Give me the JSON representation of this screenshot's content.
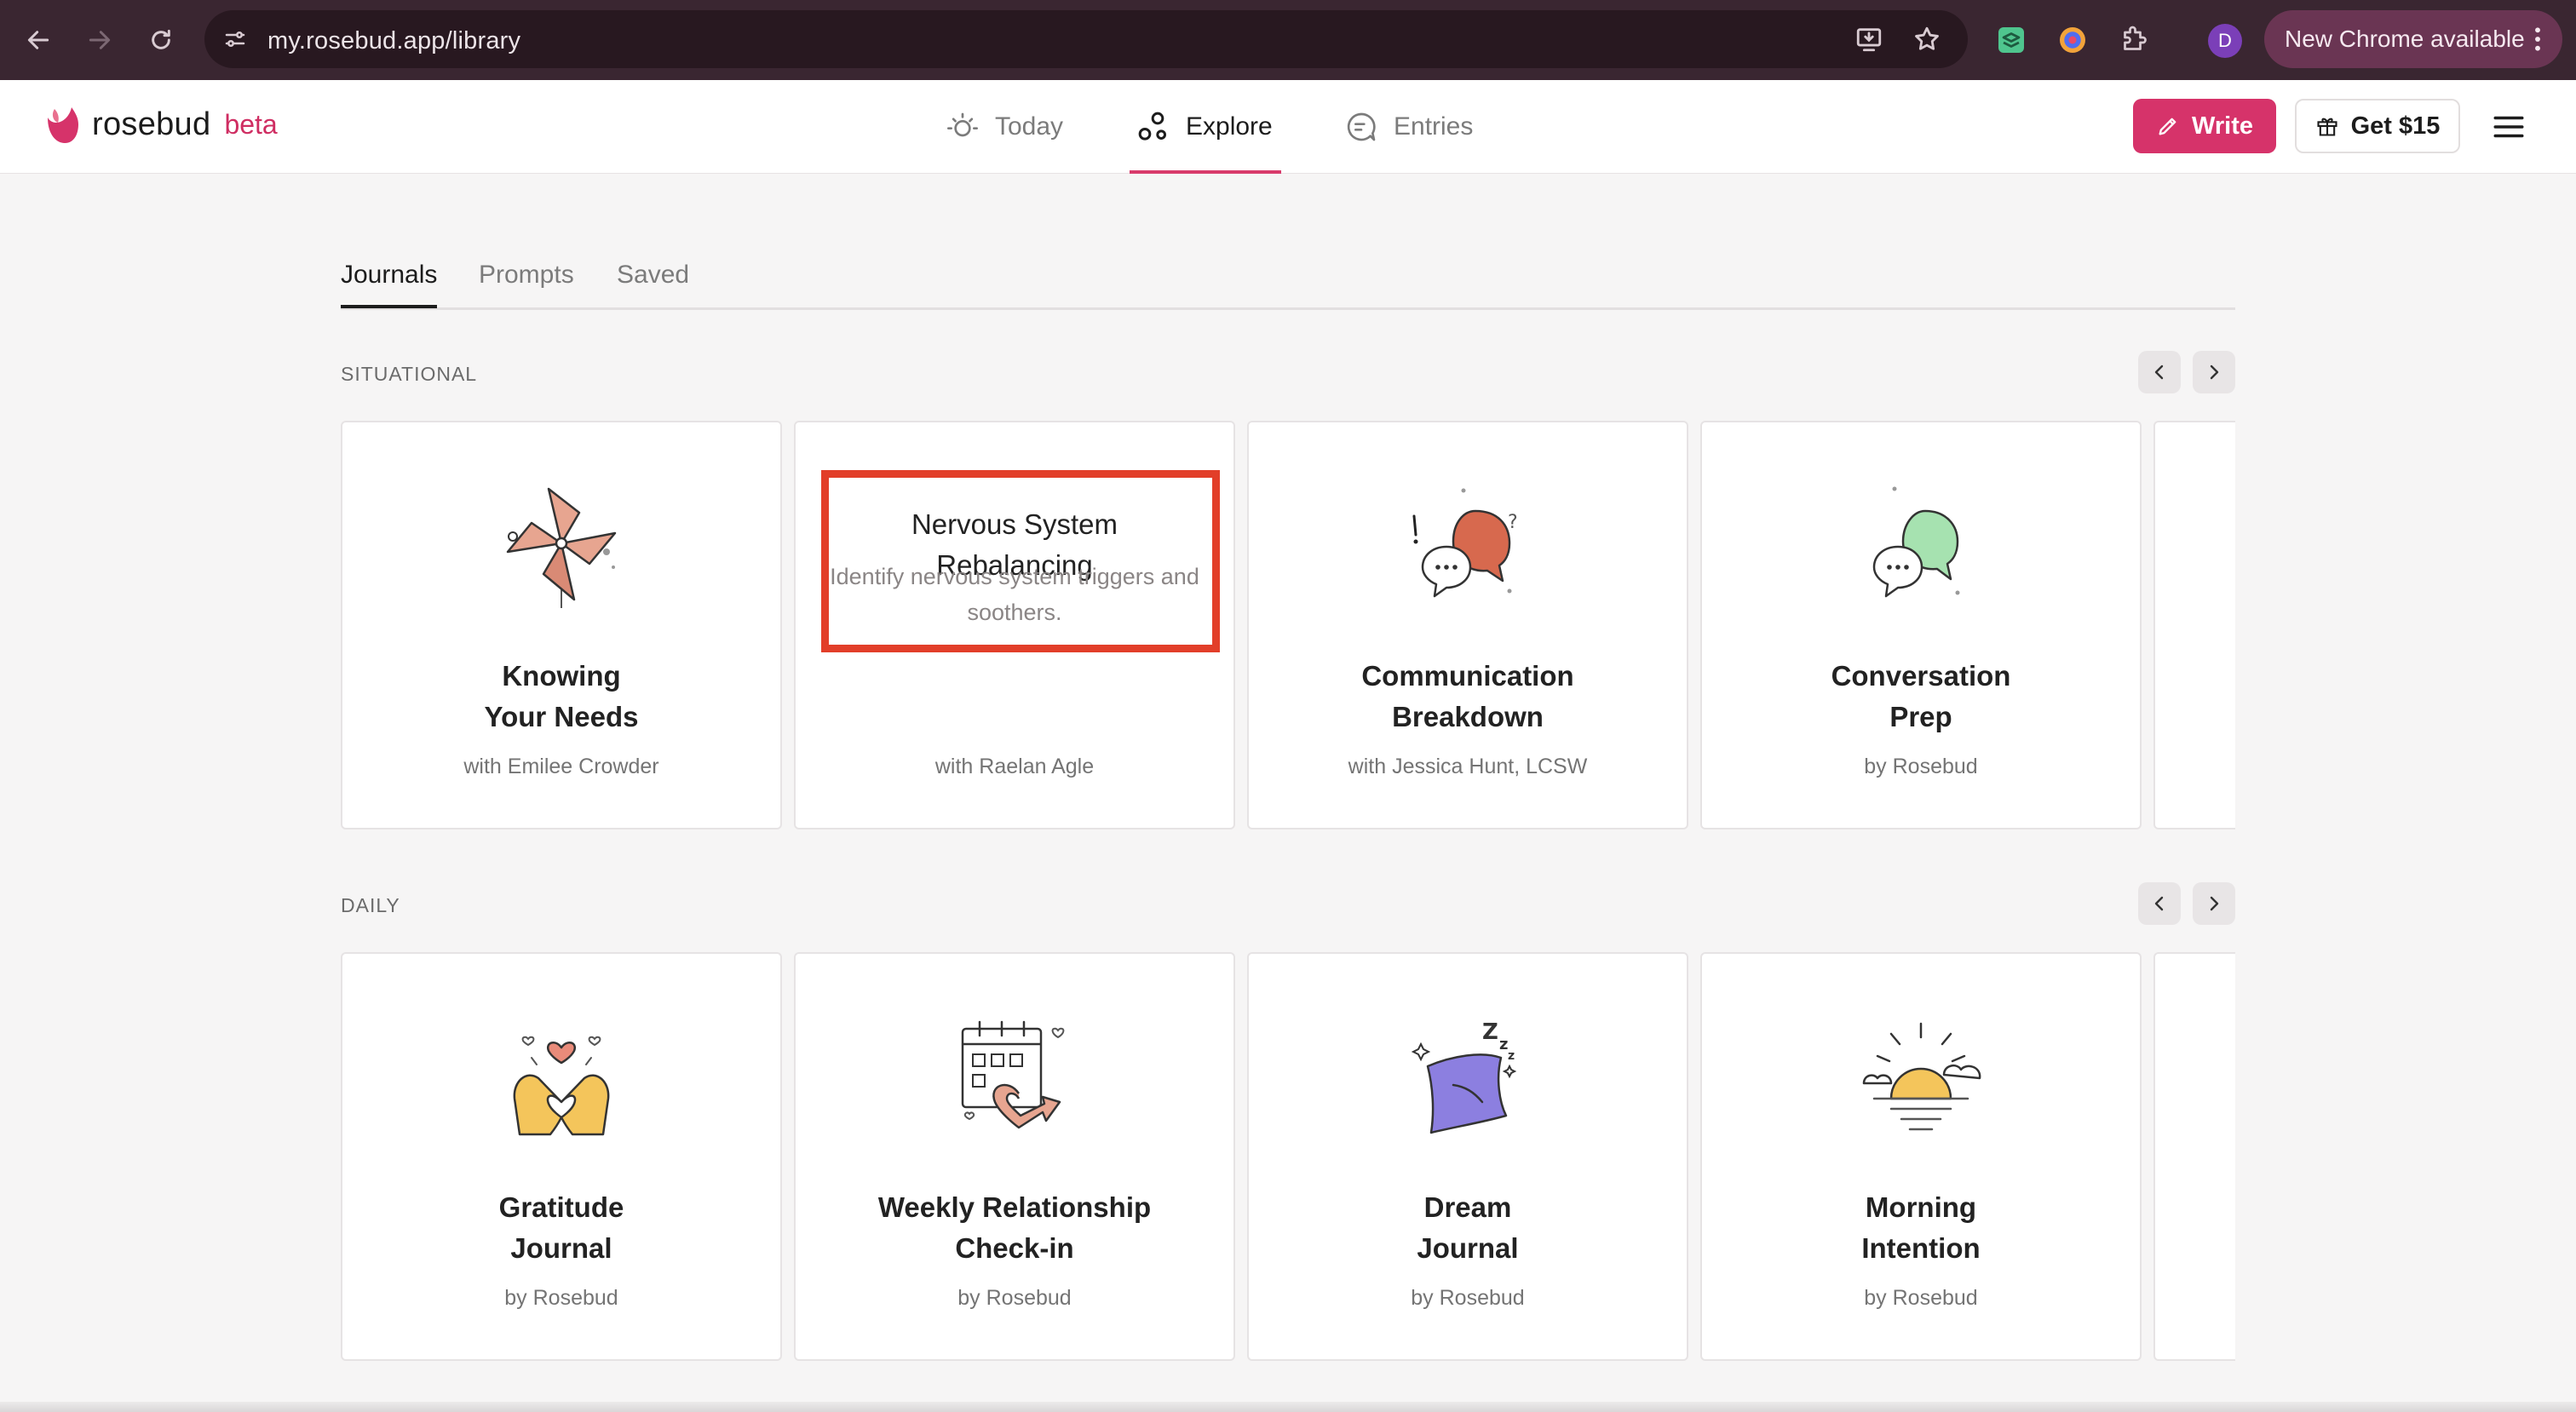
{
  "browser": {
    "url": "my.rosebud.app/library",
    "profile_initial": "D",
    "update_label": "New Chrome available"
  },
  "header": {
    "brand": "rosebud",
    "beta": "beta",
    "nav": [
      {
        "label": "Today"
      },
      {
        "label": "Explore"
      },
      {
        "label": "Entries"
      }
    ],
    "write_label": "Write",
    "referral_label": "Get $15"
  },
  "tabs": [
    {
      "label": "Journals"
    },
    {
      "label": "Prompts"
    },
    {
      "label": "Saved"
    }
  ],
  "sections": [
    {
      "label": "SITUATIONAL",
      "cards": [
        {
          "title": "Knowing\nYour Needs",
          "author": "with Emilee Crowder"
        },
        {
          "title": "Nervous System Rebalancing",
          "description": "Identify nervous system triggers and soothers.",
          "author": "with Raelan Agle"
        },
        {
          "title": "Communication\nBreakdown",
          "author": "with Jessica Hunt, LCSW"
        },
        {
          "title": "Conversation\nPrep",
          "author": "by Rosebud"
        }
      ]
    },
    {
      "label": "DAILY",
      "cards": [
        {
          "title": "Gratitude\nJournal",
          "author": "by Rosebud"
        },
        {
          "title": "Weekly Relationship\nCheck-in",
          "author": "by Rosebud"
        },
        {
          "title": "Dream\nJournal",
          "author": "by Rosebud"
        },
        {
          "title": "Morning\nIntention",
          "author": "by Rosebud"
        }
      ]
    }
  ],
  "colors": {
    "brand": "#d6336a",
    "highlight": "#e23e29",
    "chrome_bg": "#3a2631"
  }
}
